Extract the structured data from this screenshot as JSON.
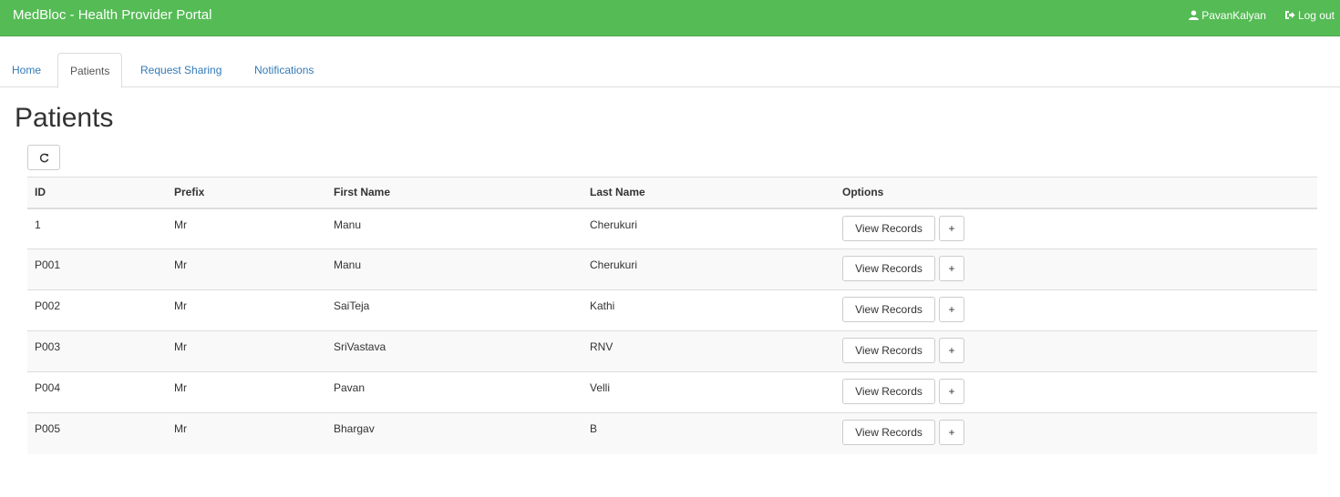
{
  "navbar": {
    "brand": "MedBloc - Health Provider Portal",
    "user_name": "PavanKalyan",
    "user_icon": "user-icon",
    "logout_label": "Log out",
    "logout_icon": "logout-icon",
    "background_color": "#55bb55"
  },
  "tabs": [
    {
      "label": "Home"
    },
    {
      "label": "Patients",
      "active": true
    },
    {
      "label": "Request Sharing"
    },
    {
      "label": "Notifications"
    }
  ],
  "main": {
    "title": "Patients",
    "refresh_icon": "refresh-icon"
  },
  "table": {
    "headers": [
      "ID",
      "Prefix",
      "First Name",
      "Last Name",
      "Options"
    ],
    "rows": [
      {
        "id": "1",
        "prefix": "Mr",
        "first_name": "Manu",
        "last_name": "Cherukuri"
      },
      {
        "id": "P001",
        "prefix": "Mr",
        "first_name": "Manu",
        "last_name": "Cherukuri"
      },
      {
        "id": "P002",
        "prefix": "Mr",
        "first_name": "SaiTeja",
        "last_name": "Kathi"
      },
      {
        "id": "P003",
        "prefix": "Mr",
        "first_name": "SriVastava",
        "last_name": "RNV"
      },
      {
        "id": "P004",
        "prefix": "Mr",
        "first_name": "Pavan",
        "last_name": "Velli"
      },
      {
        "id": "P005",
        "prefix": "Mr",
        "first_name": "Bhargav",
        "last_name": "B"
      }
    ],
    "view_records_label": "View Records",
    "add_label": "+"
  }
}
